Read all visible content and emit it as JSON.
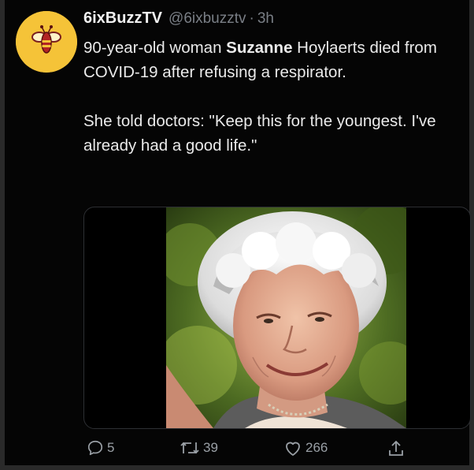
{
  "tweet": {
    "author_name": "6ixBuzzTV",
    "handle": "@6ixbuzztv",
    "separator": "·",
    "time": "3h",
    "text": {
      "line1_pre": "90-year-old woman ",
      "line1_bold": "Suzanne",
      "line1_post": " Hoylaerts died from COVID-19 after refusing a respirator.",
      "para2": "She told doctors: \"Keep this for the youngest. I've already had a good life.\""
    },
    "media": {
      "icon": "photo-elderly-woman"
    },
    "actions": {
      "replies": "5",
      "retweets": "39",
      "likes": "266"
    }
  },
  "colors": {
    "background": "#050505",
    "text": "#eaeaea",
    "muted": "#7a7f86",
    "avatar_bg": "#f5c338"
  }
}
